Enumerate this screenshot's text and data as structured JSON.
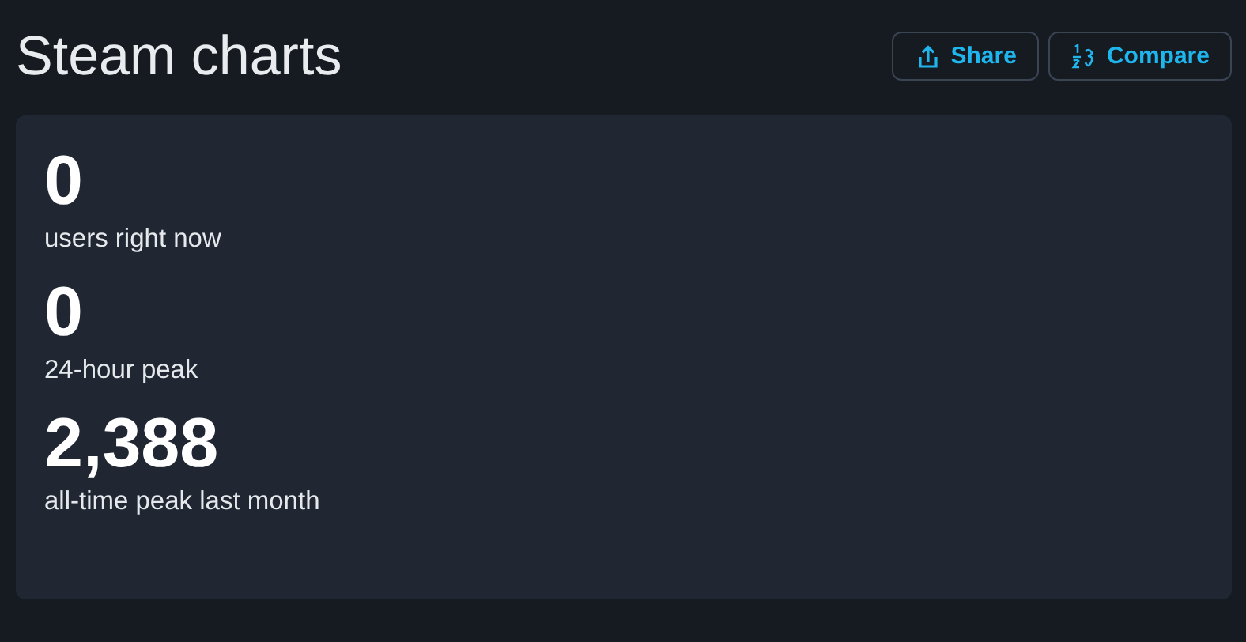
{
  "title": "Steam charts",
  "actions": [
    {
      "kind": "share",
      "label": "Share"
    },
    {
      "kind": "compare",
      "label": "Compare"
    }
  ],
  "stats": [
    {
      "value": "0",
      "label": "users right now"
    },
    {
      "value": "0",
      "label": "24-hour peak"
    },
    {
      "value": "2,388",
      "label": "all-time peak last month"
    }
  ]
}
